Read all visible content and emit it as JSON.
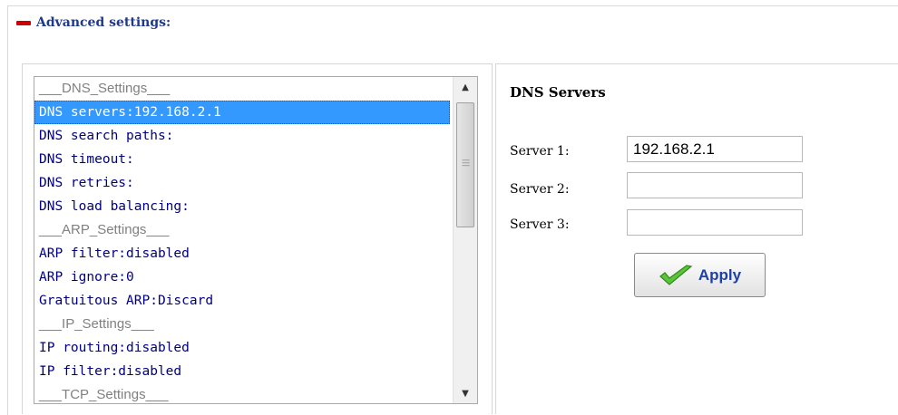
{
  "header": {
    "title": "Advanced settings:"
  },
  "list": {
    "items": [
      {
        "text": "___DNS_Settings___",
        "kind": "header"
      },
      {
        "text": "DNS servers:192.168.2.1",
        "kind": "selected"
      },
      {
        "text": "DNS search paths:",
        "kind": "item"
      },
      {
        "text": "DNS timeout:",
        "kind": "item"
      },
      {
        "text": "DNS retries:",
        "kind": "item"
      },
      {
        "text": "DNS load balancing:",
        "kind": "item"
      },
      {
        "text": "___ARP_Settings___",
        "kind": "header"
      },
      {
        "text": "ARP filter:disabled",
        "kind": "item"
      },
      {
        "text": "ARP ignore:0",
        "kind": "item"
      },
      {
        "text": "Gratuitous ARP:Discard",
        "kind": "item"
      },
      {
        "text": "___IP_Settings___",
        "kind": "header"
      },
      {
        "text": "IP routing:disabled",
        "kind": "item"
      },
      {
        "text": "IP filter:disabled",
        "kind": "item"
      },
      {
        "text": "___TCP_Settings___",
        "kind": "header"
      }
    ]
  },
  "dns_panel": {
    "title": "DNS Servers",
    "server1_label": "Server 1:",
    "server1_value": "192.168.2.1",
    "server2_label": "Server 2:",
    "server2_value": "",
    "server3_label": "Server 3:",
    "server3_value": "",
    "apply_label": "Apply"
  },
  "colors": {
    "accent": "#1f3a8a",
    "selection": "#3399ff",
    "list_text": "#000080",
    "collapse_icon": "#cc0000"
  },
  "icons": {
    "collapse": "minus-icon",
    "apply": "checkmark-icon"
  }
}
